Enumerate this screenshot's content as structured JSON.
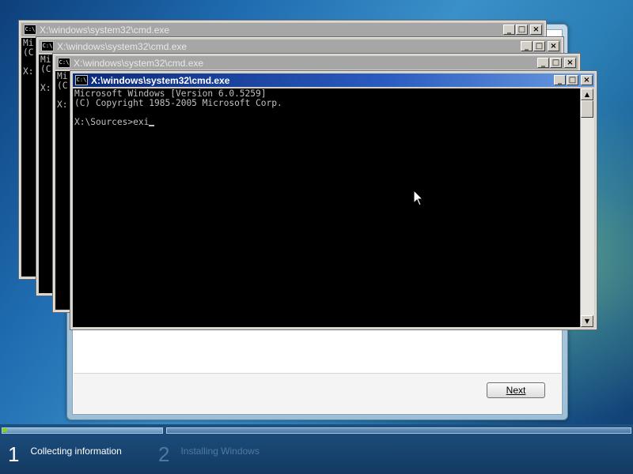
{
  "cmd_window_title": "X:\\windows\\system32\\cmd.exe",
  "cmd_icon_text": "C:\\",
  "background_windows": [
    {
      "lines": [
        "Mi",
        "(C",
        "",
        "X:"
      ]
    },
    {
      "lines": [
        "Mi",
        "(C",
        "",
        "X:"
      ]
    },
    {
      "lines": [
        "Mi",
        "(C",
        "",
        "X:"
      ]
    }
  ],
  "console": {
    "line1": "Microsoft Windows [Version 6.0.5259]",
    "line2": "(C) Copyright 1985-2005 Microsoft Corp.",
    "prompt": "X:\\Sources>",
    "typed": "exi"
  },
  "window_buttons": {
    "minimize": "_",
    "maximize": "□",
    "close": "×"
  },
  "scroll_arrows": {
    "up": "▲",
    "down": "▼"
  },
  "setup": {
    "next_label": "Next"
  },
  "progress": {
    "steps": [
      {
        "number": "1",
        "label": "Collecting information",
        "state": "active"
      },
      {
        "number": "2",
        "label": "Installing Windows",
        "state": "inactive"
      }
    ]
  },
  "colors": {
    "console_bg": "#000000",
    "console_text": "#c0c0c0",
    "active_titlebar": "#0a2a7a",
    "inactive_titlebar": "#a6a6a6"
  }
}
